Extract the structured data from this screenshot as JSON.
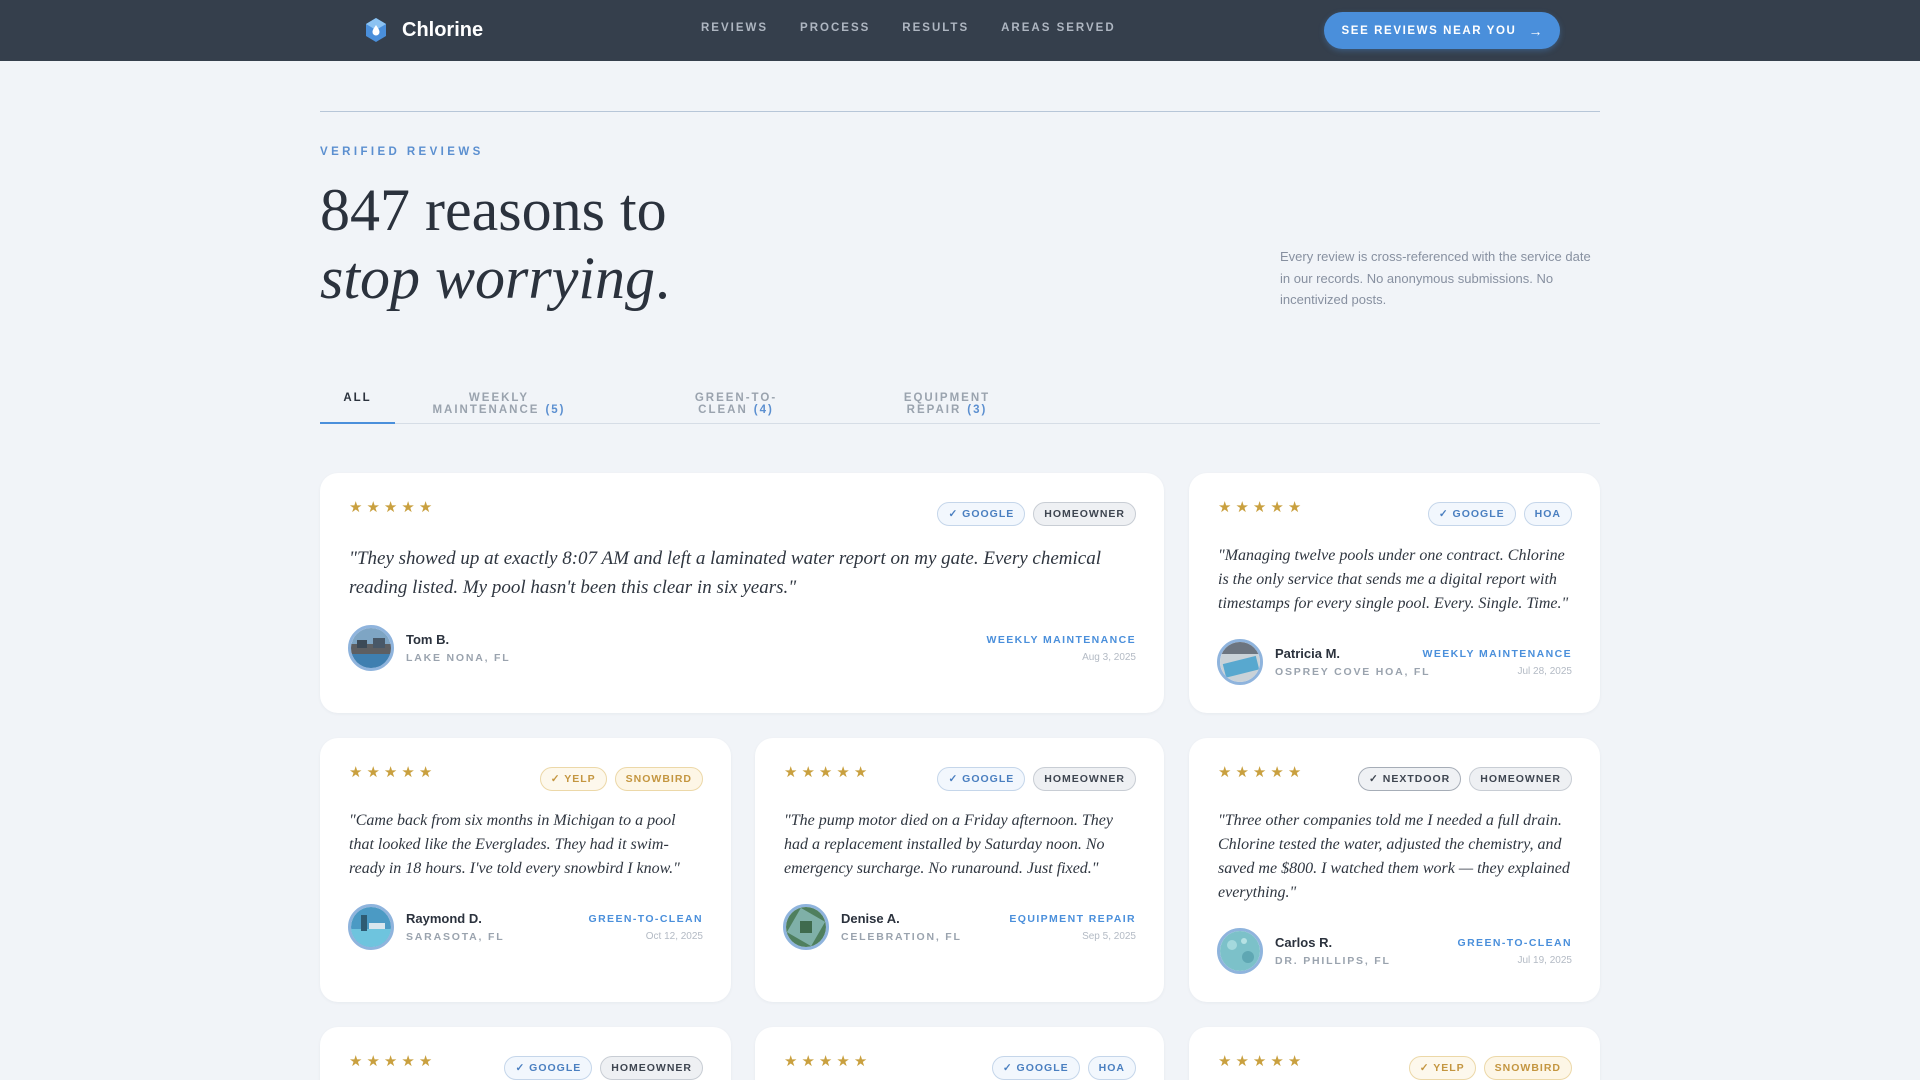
{
  "nav": {
    "brand": "Chlorine",
    "links": [
      "REVIEWS",
      "PROCESS",
      "RESULTS",
      "AREAS SERVED"
    ],
    "cta": "SEE REVIEWS NEAR YOU",
    "cta_arrow": "→"
  },
  "hero": {
    "eyebrow": "VERIFIED REVIEWS",
    "headline_line1": "847 reasons to",
    "headline_line2": "stop worrying",
    "headline_period": ".",
    "note": "Every review is cross-referenced with the service date in our records. No anonymous submissions. No incentivized posts."
  },
  "tabs": [
    {
      "label": "ALL",
      "count": "",
      "active": true
    },
    {
      "label": "WEEKLY MAINTENANCE",
      "count": "(5)",
      "active": false
    },
    {
      "label": "GREEN-TO-CLEAN",
      "count": "(4)",
      "active": false
    },
    {
      "label": "EQUIPMENT REPAIR",
      "count": "(3)",
      "active": false
    }
  ],
  "colors": {
    "accent": "#4a8fdb",
    "nav_bg": "#353f4c",
    "star": "#c9a03f",
    "page_bg": "#f1f4f8"
  },
  "stars_glyph": "★",
  "reviews": [
    {
      "rating": 5,
      "source": "✓ GOOGLE",
      "type": "HOMEOWNER",
      "quote": "\"They showed up at exactly 8:07 AM and left a laminated water report on my gate. Every chemical reading listed. My pool hasn't been this clear in six years.\"",
      "name": "Tom B.",
      "location": "LAKE NONA, FL",
      "service": "WEEKLY MAINTENANCE",
      "date": "Aug 3, 2025"
    },
    {
      "rating": 5,
      "source": "✓ GOOGLE",
      "type": "HOA",
      "quote": "\"Managing twelve pools under one contract. Chlorine is the only service that sends me a digital report with timestamps for every single pool. Every. Single. Time.\"",
      "name": "Patricia M.",
      "location": "OSPREY COVE HOA, FL",
      "service": "WEEKLY MAINTENANCE",
      "date": "Jul 28, 2025"
    },
    {
      "rating": 5,
      "source": "✓ YELP",
      "type": "SNOWBIRD",
      "quote": "\"Came back from six months in Michigan to a pool that looked like the Everglades. They had it swim-ready in 18 hours. I've told every snowbird I know.\"",
      "name": "Raymond D.",
      "location": "SARASOTA, FL",
      "service": "GREEN-TO-CLEAN",
      "date": "Oct 12, 2025"
    },
    {
      "rating": 5,
      "source": "✓ GOOGLE",
      "type": "HOMEOWNER",
      "quote": "\"The pump motor died on a Friday afternoon. They had a replacement installed by Saturday noon. No emergency surcharge. No runaround. Just fixed.\"",
      "name": "Denise A.",
      "location": "CELEBRATION, FL",
      "service": "EQUIPMENT REPAIR",
      "date": "Sep 5, 2025"
    },
    {
      "rating": 5,
      "source": "✓ NEXTDOOR",
      "type": "HOMEOWNER",
      "quote": "\"Three other companies told me I needed a full drain. Chlorine tested the water, adjusted the chemistry, and saved me $800. I watched them work — they explained everything.\"",
      "name": "Carlos R.",
      "location": "DR. PHILLIPS, FL",
      "service": "GREEN-TO-CLEAN",
      "date": "Jul 19, 2025"
    },
    {
      "rating": 5,
      "source": "✓ GOOGLE",
      "type": "HOMEOWNER"
    },
    {
      "rating": 5,
      "source": "✓ GOOGLE",
      "type": "HOA"
    },
    {
      "rating": 5,
      "source": "✓ YELP",
      "type": "SNOWBIRD"
    }
  ]
}
